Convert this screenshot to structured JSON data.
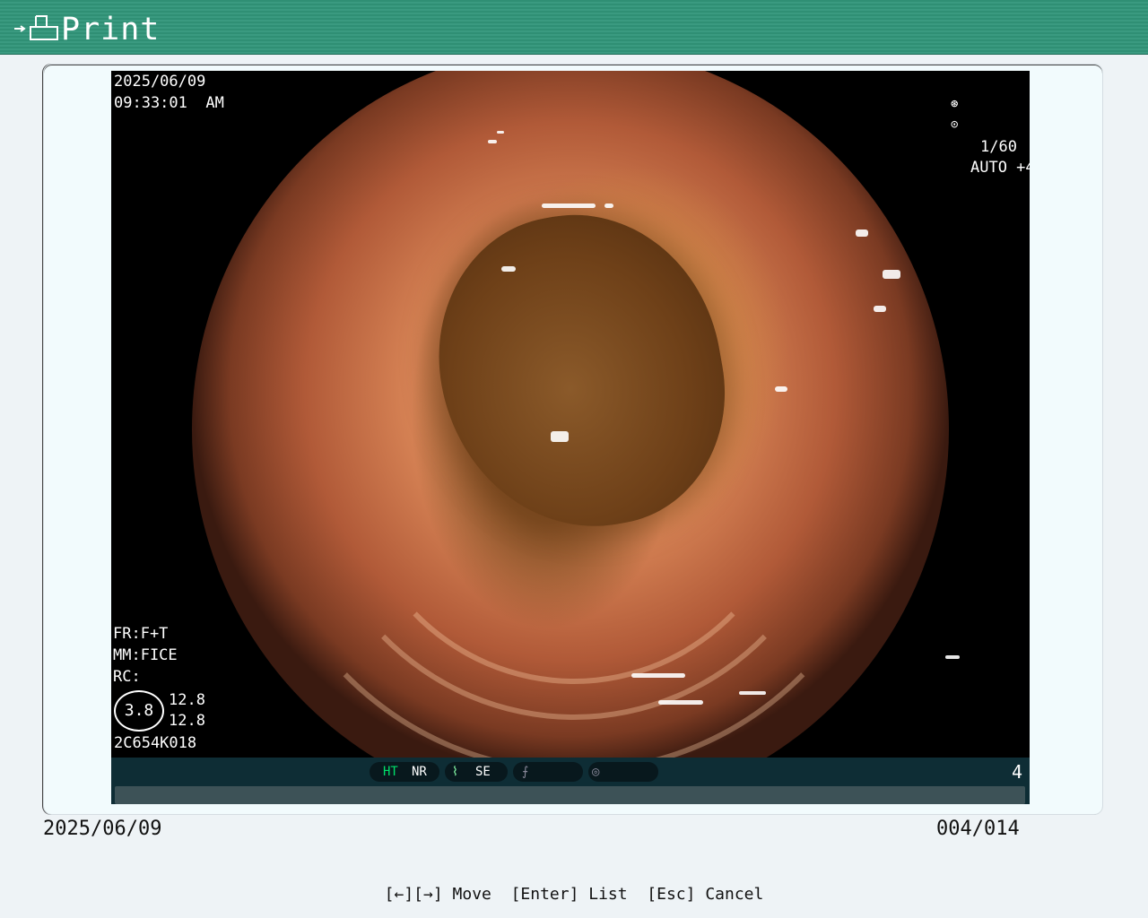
{
  "window": {
    "title": "Print",
    "title_icon": "print-icon"
  },
  "image": {
    "date": "2025/06/09",
    "time": "09:33:01",
    "meridiem": "AM",
    "shutter": "1/60",
    "iris": "AUTO +4",
    "fr": "FR:F+T",
    "mm": "MM:FICE",
    "rc": "RC:",
    "zoom": "3.8",
    "val1": "12.8",
    "val2": "12.8",
    "scope_id": "2C654K018",
    "status": {
      "ht": "HT",
      "nr": "NR",
      "se": "SE",
      "page_num": "4",
      "ht_color": "#00e06a"
    }
  },
  "footer": {
    "date": "2025/06/09",
    "count": "004/014"
  },
  "help": {
    "move": "[←][→] Move",
    "list": "[Enter] List",
    "cancel": "[Esc] Cancel"
  }
}
